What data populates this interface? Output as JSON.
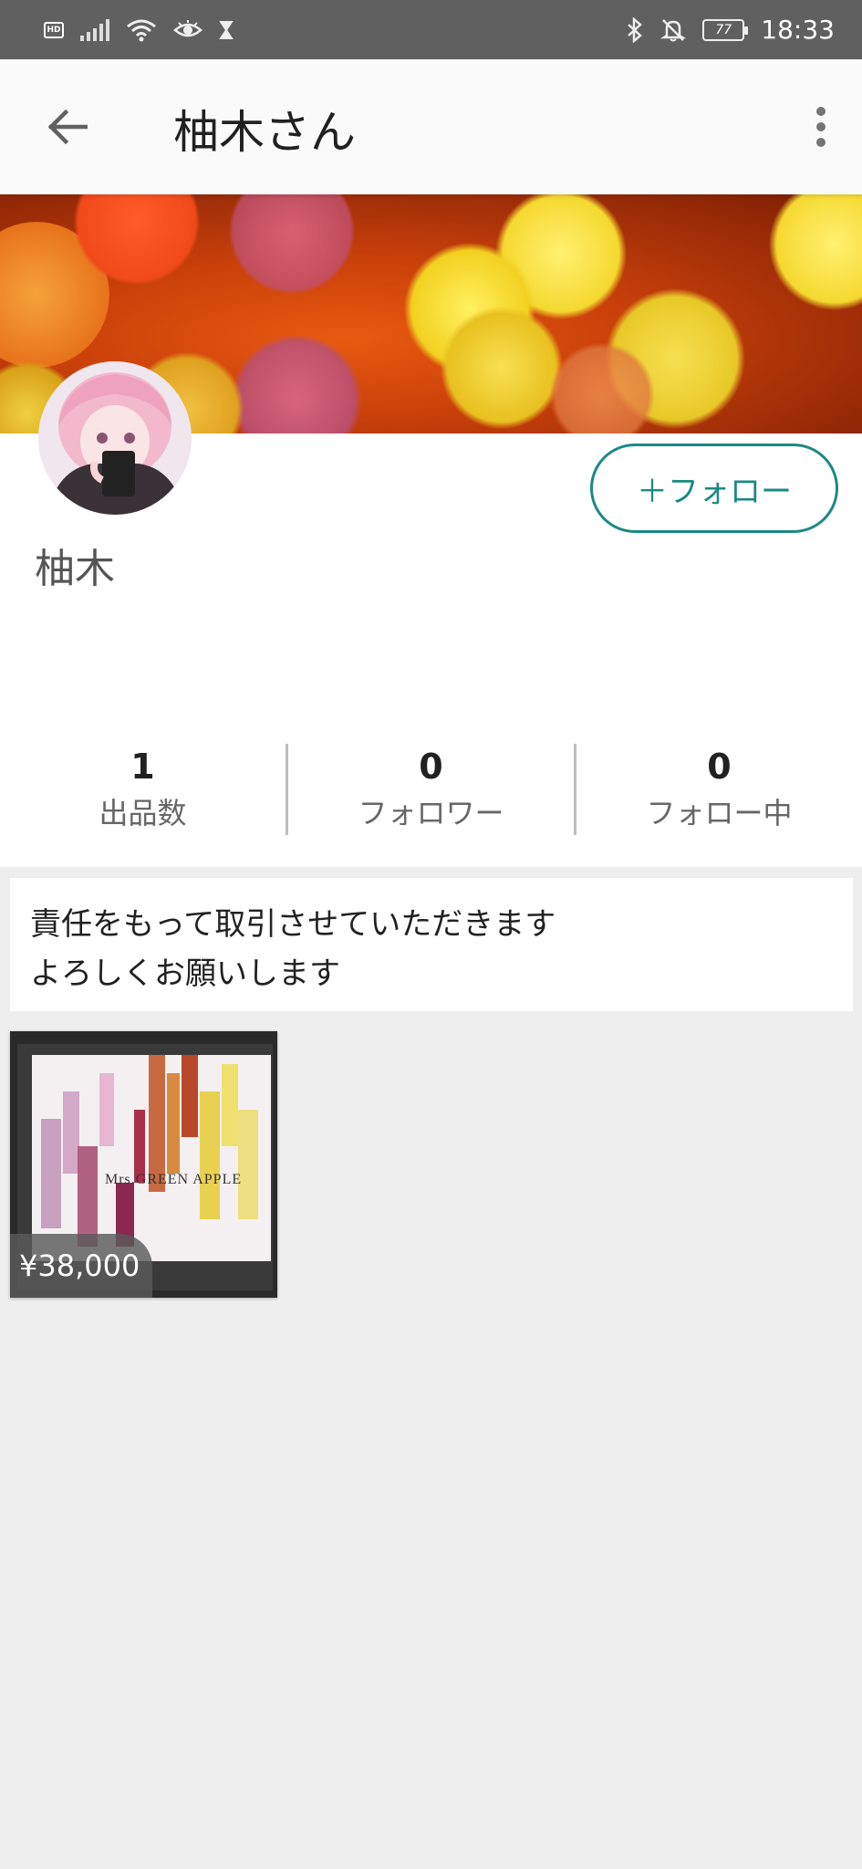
{
  "status_bar": {
    "hd": "HD",
    "battery": "77",
    "time": "18:33"
  },
  "app_bar": {
    "title": "柚木さん"
  },
  "profile": {
    "follow_label": "＋フォロー",
    "name": "柚木",
    "stats": [
      {
        "count": "1",
        "label": "出品数"
      },
      {
        "count": "0",
        "label": "フォロワー"
      },
      {
        "count": "0",
        "label": "フォロー中"
      }
    ]
  },
  "bio": {
    "line1": "責任をもって取引させていただきます",
    "line2": "よろしくお願いします"
  },
  "items": [
    {
      "price": "¥38,000",
      "cover_text": "Mrs.GREEN APPLE"
    }
  ],
  "colors": {
    "accent": "#1b8a83",
    "status_bar": "#606060",
    "background": "#eeeeee"
  },
  "icons": {
    "back": "arrow-left-icon",
    "more": "more-vert-icon"
  }
}
